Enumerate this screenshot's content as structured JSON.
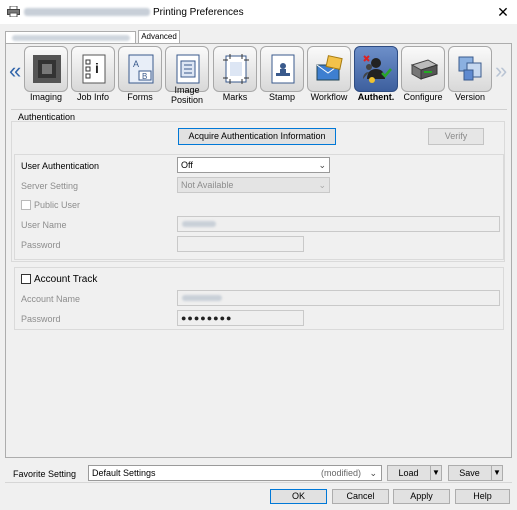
{
  "window": {
    "title": "Printing Preferences",
    "close_glyph": "✕"
  },
  "tabs": {
    "basic": "",
    "advanced": "Advanced"
  },
  "toolbar": {
    "prev_glyph": "«",
    "next_glyph": "»",
    "items": [
      {
        "label": "Imaging",
        "icon": "imaging-icon"
      },
      {
        "label": "Job Info",
        "icon": "job-info-icon"
      },
      {
        "label": "Forms",
        "icon": "forms-icon"
      },
      {
        "label": "Image Position",
        "label_line1": "Image",
        "label_line2": "Position",
        "icon": "image-position-icon"
      },
      {
        "label": "Marks",
        "icon": "marks-icon"
      },
      {
        "label": "Stamp",
        "icon": "stamp-icon"
      },
      {
        "label": "Workflow",
        "icon": "workflow-icon"
      },
      {
        "label": "Authent.",
        "icon": "authentication-icon",
        "selected": true
      },
      {
        "label": "Configure",
        "icon": "configure-icon"
      },
      {
        "label": "Version",
        "icon": "version-icon"
      }
    ]
  },
  "authentication": {
    "section_title": "Authentication",
    "acquire_button": "Acquire Authentication Information",
    "verify_button": "Verify",
    "user_auth_label": "User Authentication",
    "user_auth_value": "Off",
    "server_setting_label": "Server Setting",
    "server_setting_value": "Not Available",
    "public_user_label": "Public User",
    "user_name_label": "User Name",
    "password_label": "Password"
  },
  "account_track": {
    "checkbox_label": "Account Track",
    "account_name_label": "Account Name",
    "password_label": "Password",
    "password_value": "●●●●●●●●"
  },
  "footer": {
    "favorite_label": "Favorite Setting",
    "favorite_value": "Default Settings",
    "favorite_modified": "(modified)",
    "load_button": "Load",
    "save_button": "Save",
    "ok_button": "OK",
    "cancel_button": "Cancel",
    "apply_button": "Apply",
    "help_button": "Help"
  },
  "colors": {
    "accent": "#0078d7",
    "selected_tile": "#3d5f9e"
  }
}
